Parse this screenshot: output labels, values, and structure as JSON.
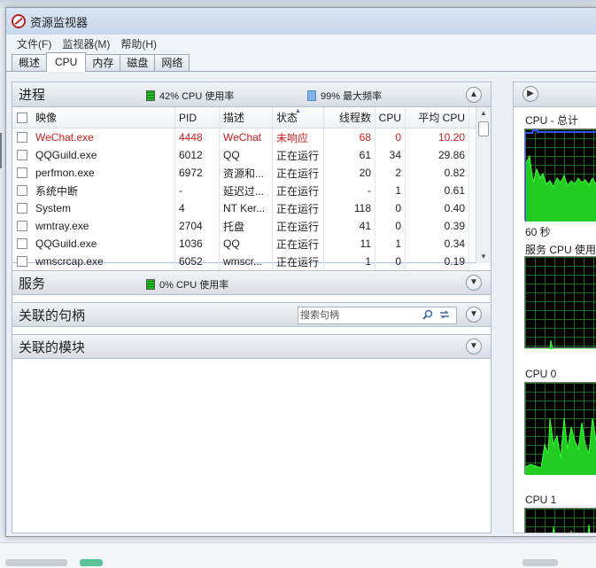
{
  "window": {
    "title": "资源监视器"
  },
  "menu": [
    "文件(F)",
    "监视器(M)",
    "帮助(H)"
  ],
  "tabs": [
    "概述",
    "CPU",
    "内存",
    "磁盘",
    "网络"
  ],
  "processes": {
    "title": "进程",
    "cpu_usage": "42% CPU 使用率",
    "max_freq": "99% 最大频率",
    "columns": {
      "image": "映像",
      "pid": "PID",
      "desc": "描述",
      "status": "状态",
      "threads": "线程数",
      "cpu": "CPU",
      "avg_cpu": "平均 CPU"
    },
    "rows": [
      {
        "image": "WeChat.exe",
        "pid": "4448",
        "desc": "WeChat",
        "status": "未响应",
        "threads": "68",
        "cpu": "0",
        "avg": "10.20",
        "highlight": true
      },
      {
        "image": "QQGuild.exe",
        "pid": "6012",
        "desc": "QQ",
        "status": "正在运行",
        "threads": "61",
        "cpu": "34",
        "avg": "29.86",
        "highlight": false
      },
      {
        "image": "perfmon.exe",
        "pid": "6972",
        "desc": "资源和...",
        "status": "正在运行",
        "threads": "20",
        "cpu": "2",
        "avg": "0.82",
        "highlight": false
      },
      {
        "image": "系统中断",
        "pid": "-",
        "desc": "延迟过...",
        "status": "正在运行",
        "threads": "-",
        "cpu": "1",
        "avg": "0.61",
        "highlight": false
      },
      {
        "image": "System",
        "pid": "4",
        "desc": "NT Ker...",
        "status": "正在运行",
        "threads": "118",
        "cpu": "0",
        "avg": "0.40",
        "highlight": false
      },
      {
        "image": "wmtray.exe",
        "pid": "2704",
        "desc": "托盘",
        "status": "正在运行",
        "threads": "41",
        "cpu": "0",
        "avg": "0.39",
        "highlight": false
      },
      {
        "image": "QQGuild.exe",
        "pid": "1036",
        "desc": "QQ",
        "status": "正在运行",
        "threads": "11",
        "cpu": "1",
        "avg": "0.34",
        "highlight": false
      },
      {
        "image": "wmscrcap.exe",
        "pid": "6052",
        "desc": "wmscr...",
        "status": "正在运行",
        "threads": "1",
        "cpu": "0",
        "avg": "0.19",
        "highlight": false
      }
    ]
  },
  "services": {
    "title": "服务",
    "cpu_usage": "0% CPU 使用率"
  },
  "handles": {
    "title": "关联的句柄",
    "search_placeholder": "搜索句柄"
  },
  "modules": {
    "title": "关联的模块"
  },
  "graphs": {
    "cpu_total": "CPU - 总计",
    "time_span": "60 秒",
    "service_cpu": "服务 CPU 使用率",
    "cpu0": "CPU 0",
    "cpu1": "CPU 1"
  },
  "colors": {
    "highlight_text": "#d41a1a",
    "graph_green": "#22cc22",
    "graph_blue": "#3355ff"
  },
  "icons": {
    "expand": "chevron-down-icon",
    "collapse": "chevron-up-icon",
    "search": "search-icon",
    "refresh": "refresh-icon"
  }
}
